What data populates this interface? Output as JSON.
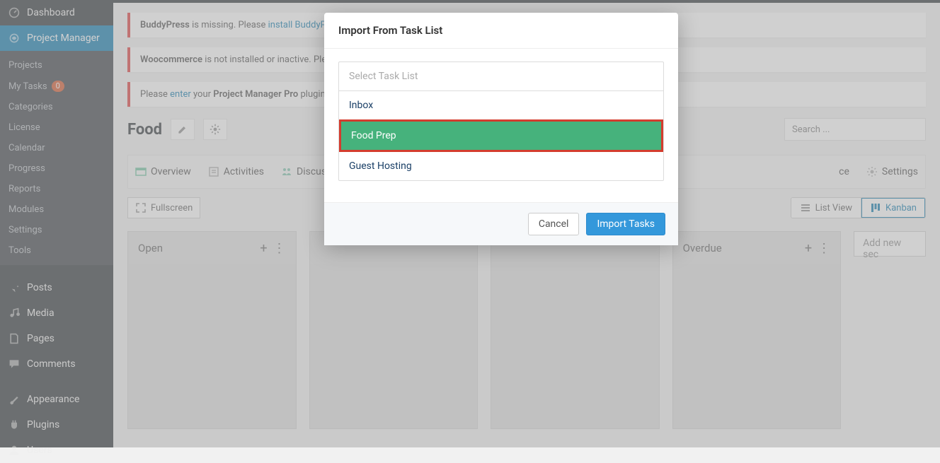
{
  "sidebar": {
    "dashboard": "Dashboard",
    "project_manager": "Project Manager",
    "submenu": {
      "projects": "Projects",
      "my_tasks": "My Tasks",
      "my_tasks_count": "0",
      "categories": "Categories",
      "license": "License",
      "calendar": "Calendar",
      "progress": "Progress",
      "reports": "Reports",
      "modules": "Modules",
      "settings": "Settings",
      "tools": "Tools"
    },
    "posts": "Posts",
    "media": "Media",
    "pages": "Pages",
    "comments": "Comments",
    "appearance": "Appearance",
    "plugins": "Plugins",
    "users": "Users"
  },
  "notices": {
    "n1_a": "BuddyPress",
    "n1_b": " is missing. Please ",
    "n1_link": "install BuddyP",
    "n2_a": "Woocommerce",
    "n2_b": " is not installed or inactive. Plea",
    "n3_a": "Please ",
    "n3_link": "enter",
    "n3_b": " your ",
    "n3_c": "Project Manager Pro",
    "n3_d": " plugin"
  },
  "project": {
    "title": "Food"
  },
  "search": {
    "placeholder": "Search ..."
  },
  "tabs": {
    "overview": "Overview",
    "activities": "Activities",
    "discuss": "Discuss",
    "hidden_end": "ce",
    "settings": "Settings"
  },
  "toolbar": {
    "fullscreen": "Fullscreen",
    "list_view": "List View",
    "kanban": "Kanban"
  },
  "board": {
    "col1": "Open",
    "col2": "Overdue",
    "add": "Add new sec"
  },
  "modal": {
    "title": "Import From Task List",
    "select_placeholder": "Select Task List",
    "options": [
      "Inbox",
      "Food Prep",
      "Guest Hosting"
    ],
    "cancel": "Cancel",
    "import": "Import Tasks"
  }
}
